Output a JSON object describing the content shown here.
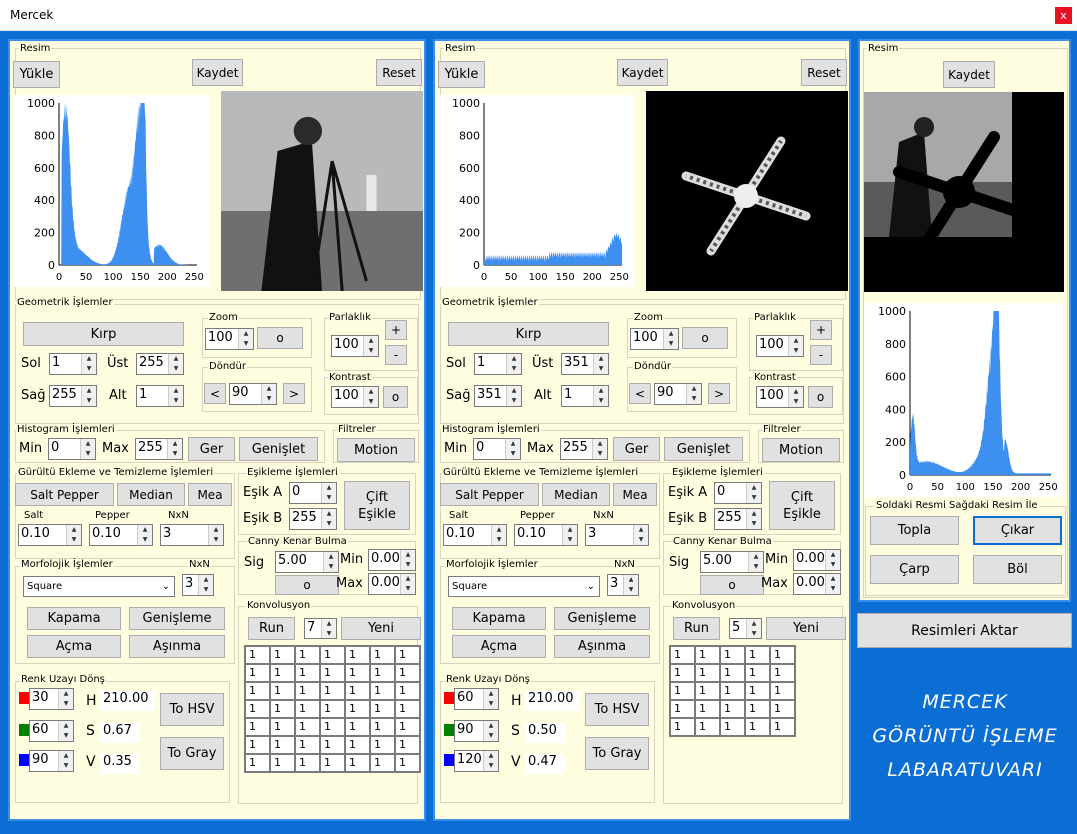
{
  "window": {
    "title": "Mercek",
    "close": "x"
  },
  "hist_axis": {
    "y": [
      "1000",
      "800",
      "600",
      "400",
      "200",
      "0"
    ],
    "x": [
      "0",
      "50",
      "100",
      "150",
      "200",
      "250"
    ],
    "ymax": 1000,
    "xmax": 255
  },
  "left": {
    "resim": "Resim",
    "yukle": "Yükle",
    "kaydet": "Kaydet",
    "reset": "Reset",
    "geo": "Geometrik İşlemler",
    "kirp": "Kırp",
    "sol": "Sol",
    "sol_v": "1",
    "ust": "Üst",
    "ust_v": "255",
    "sag": "Sağ",
    "sag_v": "255",
    "alt": "Alt",
    "alt_v": "1",
    "zoom": "Zoom",
    "zoom_v": "100",
    "zoom_btn": "o",
    "dondur": "Döndür",
    "dondur_v": "90",
    "prev": "<",
    "next": ">",
    "parlaklik": "Parlaklık",
    "parlaklik_v": "100",
    "plus": "+",
    "minus": "-",
    "kontrast": "Kontrast",
    "kontrast_v": "100",
    "kontrast_btn": "o",
    "histo": "Histogram İşlemleri",
    "min": "Min",
    "min_v": "0",
    "max": "Max",
    "max_v": "255",
    "ger": "Ger",
    "genislet": "Genişlet",
    "filtreler": "Filtreler",
    "motion": "Motion",
    "gurultu": "Gürültü Ekleme ve Temizleme İşlemleri",
    "saltpepper": "Salt Pepper",
    "median": "Median",
    "mea": "Mea",
    "salt": "Salt",
    "salt_v": "0.10",
    "pepper": "Pepper",
    "pepper_v": "0.10",
    "nxn": "NxN",
    "nxn_v": "3",
    "esik": "Eşikleme İşlemleri",
    "esika": "Eşik A",
    "esika_v": "0",
    "esikb": "Eşik B",
    "esikb_v": "255",
    "cift": "Çift Eşikle",
    "morf": "Morfolojik İşlemler",
    "square": "Square",
    "m_nxn": "NxN",
    "m_nxn_v": "3",
    "kapama": "Kapama",
    "genisleme": "Genişleme",
    "acma": "Açma",
    "asinma": "Aşınma",
    "canny": "Canny Kenar Bulma",
    "sig": "Sig",
    "sig_v": "5.00",
    "cmin": "Min",
    "cmin_v": "0.00",
    "cmax": "Max",
    "cmax_v": "0.00",
    "canny_btn": "o",
    "konv": "Konvolusyon",
    "run": "Run",
    "konv_n": "7",
    "yeni": "Yeni",
    "renk": "Renk Uzayı Dönş",
    "r": "30",
    "g": "60",
    "b": "90",
    "h_l": "H",
    "h": "210.00",
    "s_l": "S",
    "s": "0.67",
    "v_l": "V",
    "v": "0.35",
    "tohsv": "To HSV",
    "togray": "To Gray"
  },
  "mid": {
    "resim": "Resim",
    "yukle": "Yükle",
    "kaydet": "Kaydet",
    "reset": "Reset",
    "geo": "Geometrik İşlemler",
    "kirp": "Kırp",
    "sol": "Sol",
    "sol_v": "1",
    "ust": "Üst",
    "ust_v": "351",
    "sag": "Sağ",
    "sag_v": "351",
    "alt": "Alt",
    "alt_v": "1",
    "zoom": "Zoom",
    "zoom_v": "100",
    "zoom_btn": "o",
    "dondur": "Döndür",
    "dondur_v": "90",
    "prev": "<",
    "next": ">",
    "parlaklik": "Parlaklık",
    "parlaklik_v": "100",
    "plus": "+",
    "minus": "-",
    "kontrast": "Kontrast",
    "kontrast_v": "100",
    "kontrast_btn": "o",
    "histo": "Histogram İşlemleri",
    "min": "Min",
    "min_v": "0",
    "max": "Max",
    "max_v": "255",
    "ger": "Ger",
    "genislet": "Genişlet",
    "filtreler": "Filtreler",
    "motion": "Motion",
    "gurultu": "Gürültü Ekleme ve Temizleme İşlemleri",
    "saltpepper": "Salt Pepper",
    "median": "Median",
    "mea": "Mea",
    "salt": "Salt",
    "salt_v": "0.10",
    "pepper": "Pepper",
    "pepper_v": "0.10",
    "nxn": "NxN",
    "nxn_v": "3",
    "esik": "Eşikleme İşlemleri",
    "esika": "Eşik A",
    "esika_v": "0",
    "esikb": "Eşik B",
    "esikb_v": "255",
    "cift": "Çift Eşikle",
    "morf": "Morfolojik İşlemler",
    "square": "Square",
    "m_nxn": "NxN",
    "m_nxn_v": "3",
    "kapama": "Kapama",
    "genisleme": "Genişleme",
    "acma": "Açma",
    "asinma": "Aşınma",
    "canny": "Canny Kenar Bulma",
    "sig": "Sig",
    "sig_v": "5.00",
    "cmin": "Min",
    "cmin_v": "0.00",
    "cmax": "Max",
    "cmax_v": "0.00",
    "canny_btn": "o",
    "konv": "Konvolusyon",
    "run": "Run",
    "konv_n": "5",
    "yeni": "Yeni",
    "renk": "Renk Uzayı Dönş",
    "r": "60",
    "g": "90",
    "b": "120",
    "h_l": "H",
    "h": "210.00",
    "s_l": "S",
    "s": "0.50",
    "v_l": "V",
    "v": "0.47",
    "tohsv": "To HSV",
    "togray": "To Gray"
  },
  "right": {
    "resim": "Resim",
    "kaydet": "Kaydet",
    "ops": "Soldaki Resmi Sağdaki Resim İle",
    "topla": "Topla",
    "cikar": "Çıkar",
    "carp": "Çarp",
    "bol": "Böl",
    "aktar": "Resimleri Aktar"
  },
  "brand": {
    "l1": "MERCEK",
    "l2": "GÖRÜNTÜ İŞLEME",
    "l3": "LABARATUVARI"
  },
  "kernel_left": {
    "rows": 7,
    "cols": 7,
    "value": "1"
  },
  "kernel_mid": {
    "rows": 5,
    "cols": 5,
    "value": "1"
  },
  "colors": {
    "hist": "#3d8ff0",
    "brand_bg": "#0a6ed4",
    "panel": "#fffde0",
    "red": "#ff0000",
    "green": "#008000",
    "blue": "#0000ff"
  },
  "icons": {
    "spin": "updown-arrows-icon",
    "combo": "chevron-down-icon"
  }
}
